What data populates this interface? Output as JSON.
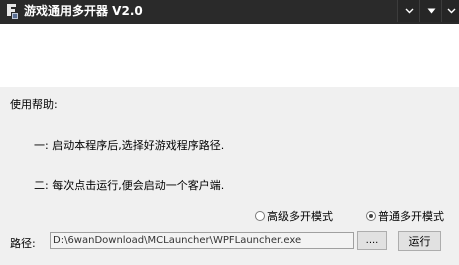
{
  "window": {
    "title": "游戏通用多开器 V2.0"
  },
  "titlebar_buttons": {
    "minimize_icon": "chevron-down-icon",
    "maximize_icon": "triangle-down-icon",
    "close_icon": "chevron-down-icon"
  },
  "help": {
    "title": "使用帮助:",
    "line1": "一: 启动本程序后,选择好游戏程序路径.",
    "line2": "二: 每次点击运行,便会启动一个客户端."
  },
  "mode": {
    "advanced_label": "高级多开模式",
    "advanced_selected": false,
    "normal_label": "普通多开模式",
    "normal_selected": true
  },
  "path": {
    "label": "路径:",
    "value": "D:\\6wanDownload\\MCLauncher\\WPFLauncher.exe",
    "browse_label": "....",
    "run_label": "运行"
  },
  "colors": {
    "titlebar_bg": "#2a2a2a",
    "body_bg": "#f0f0f0",
    "banner_bg": "#ffffff"
  }
}
